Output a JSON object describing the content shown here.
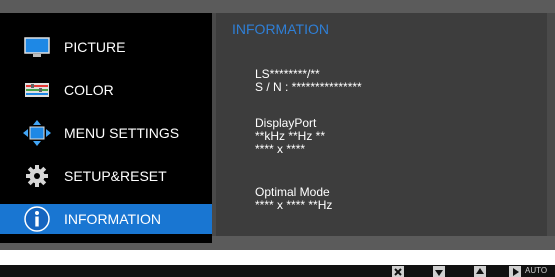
{
  "sidebar": {
    "items": [
      {
        "label": "PICTURE"
      },
      {
        "label": "COLOR"
      },
      {
        "label": "MENU SETTINGS"
      },
      {
        "label": "SETUP&RESET"
      },
      {
        "label": "INFORMATION",
        "active": true
      }
    ]
  },
  "panel": {
    "title": "INFORMATION",
    "model": "LS********/**",
    "serial": "S / N : ***************",
    "input_source": "DisplayPort",
    "frequency": "**kHz **Hz **",
    "resolution": "**** x ****",
    "optimal_label": "Optimal Mode",
    "optimal_value": "**** x **** **Hz"
  },
  "bottom_bar": {
    "auto_label": "AUTO"
  },
  "colors": {
    "accent": "#1976d2",
    "title_blue": "#2f7fd6"
  }
}
